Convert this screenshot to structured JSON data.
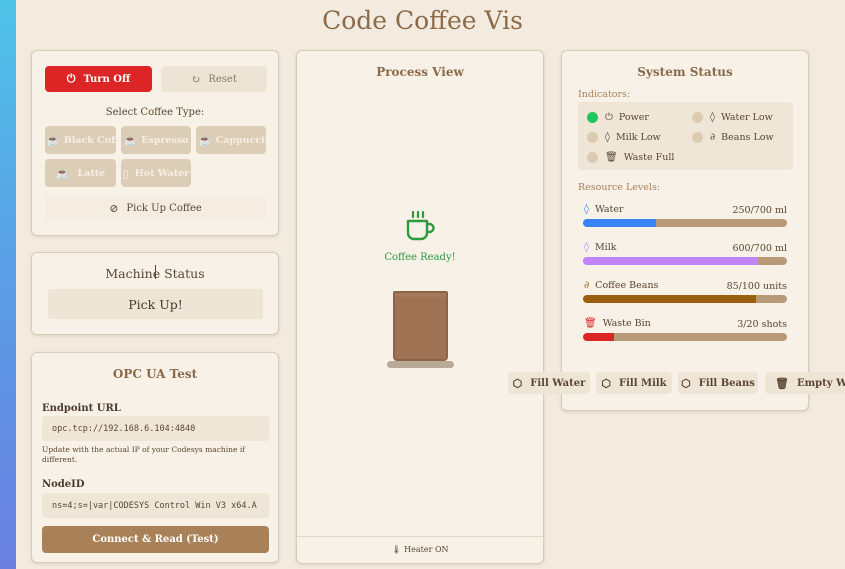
{
  "app": {
    "title": "Code Coffee Vis"
  },
  "controls": {
    "turn_off_label": "Turn Off",
    "reset_label": "Reset",
    "select_type_label": "Select Coffee Type:",
    "coffee_types": [
      "Black Coffee",
      "Espresso",
      "Cappuccino",
      "Latte",
      "Hot Water"
    ],
    "pick_up_label": "Pick Up Coffee"
  },
  "machine_status": {
    "title": "Machine Status",
    "value": "Pick Up!"
  },
  "opc": {
    "title": "OPC UA Test",
    "endpoint_label": "Endpoint URL",
    "endpoint_value": "opc.tcp://192.168.6.104:4840",
    "hint": "Update with the actual IP of your Codesys machine if different.",
    "node_label": "NodeID",
    "node_value": "ns=4;s=|var|CODESYS Control Win V3 x64.A",
    "connect_label": "Connect & Read (Test)"
  },
  "process": {
    "title": "Process View",
    "status_text": "Coffee Ready!",
    "footer_text": "Heater ON"
  },
  "system_status": {
    "title": "System Status",
    "indicators_label": "Indicators:",
    "indicators": [
      {
        "label": "Power",
        "active": true
      },
      {
        "label": "Water Low",
        "active": false
      },
      {
        "label": "Milk Low",
        "active": false
      },
      {
        "label": "Beans Low",
        "active": false
      },
      {
        "label": "Waste Full",
        "active": false
      }
    ],
    "resource_label": "Resource Levels:",
    "resources": [
      {
        "label": "Water",
        "value_text": "250/700 ml",
        "level": 0.357,
        "color": "#3b82f6"
      },
      {
        "label": "Milk",
        "value_text": "600/700 ml",
        "level": 0.857,
        "color": "#c084fc"
      },
      {
        "label": "Coffee Beans",
        "value_text": "85/100 units",
        "level": 0.85,
        "color": "#9a6010"
      },
      {
        "label": "Waste Bin",
        "value_text": "3/20 shots",
        "level": 0.15,
        "color": "#dc2626"
      }
    ]
  },
  "actions": {
    "fill_water": "Fill Water",
    "fill_milk": "Fill Milk",
    "fill_beans": "Fill Beans",
    "empty_waste": "Empty Waste"
  },
  "colors": {
    "accent_red": "#dc2626",
    "accent_brown": "#a98158",
    "ready_green": "#2e9a3e",
    "power_green": "#22c55e"
  }
}
